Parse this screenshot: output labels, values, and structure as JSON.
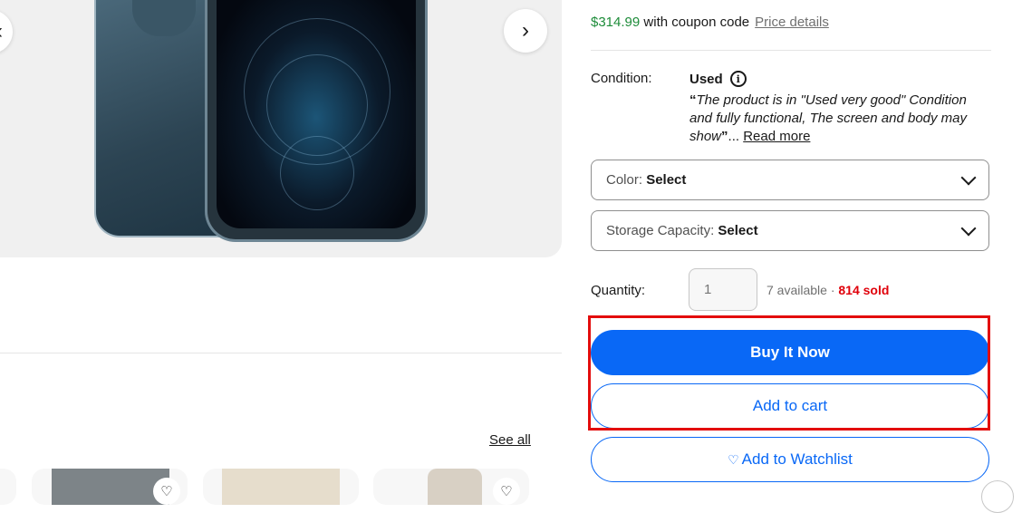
{
  "gallery": {
    "prev_icon": "chevron-left-icon",
    "next_icon": "chevron-right-icon",
    "prev_glyph": "‹",
    "next_glyph": "›"
  },
  "pricing": {
    "coupon_price": "$314.99",
    "coupon_text": " with coupon code",
    "price_details_link": "Price details"
  },
  "condition": {
    "label": "Condition:",
    "value": "Used",
    "info_icon": "info-icon",
    "quote_open": "“",
    "quote_text": "The product is in \"Used very good\" Condition and fully functional, The screen and body may show",
    "quote_close": "”",
    "ellipsis": "...",
    "read_more": "Read more"
  },
  "variations": [
    {
      "name": "Color: ",
      "value": "Select"
    },
    {
      "name": "Storage Capacity: ",
      "value": "Select"
    }
  ],
  "quantity": {
    "label": "Quantity:",
    "placeholder": "1",
    "available": "7 available · ",
    "sold": "814 sold"
  },
  "actions": {
    "buy_now": "Buy It Now",
    "add_to_cart": "Add to cart",
    "watchlist_icon": "♡",
    "add_to_watchlist": "Add to Watchlist"
  },
  "similar": {
    "see_all": "See all",
    "heart_glyph": "♡"
  },
  "colors": {
    "accent_blue": "#0968f6",
    "coupon_green": "#1e8c3a",
    "sold_red": "#e0000a",
    "highlight_red": "#e30d0d"
  }
}
